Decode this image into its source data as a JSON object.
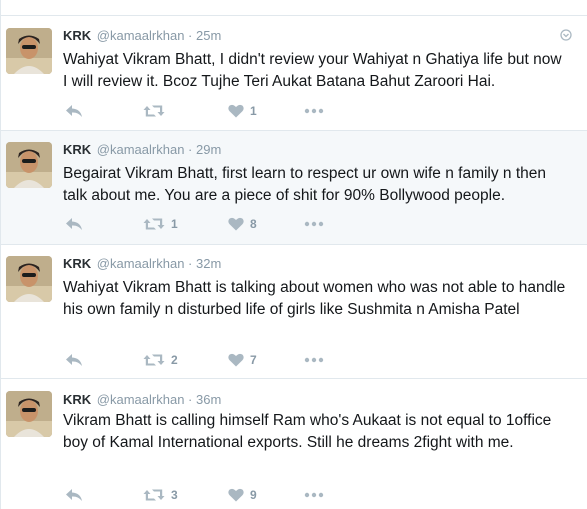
{
  "icons": {
    "reply": "reply-icon",
    "retweet": "retweet-icon",
    "like": "heart-icon",
    "more": "more-dots-icon",
    "caret": "caret-down-icon"
  },
  "colors": {
    "name": "#292f33",
    "muted": "#8899a6",
    "text": "#14171a",
    "icon": "#aab8c2",
    "highlight_bg": "#f5f8fa",
    "border": "#e1e8ed"
  },
  "tweets": [
    {
      "name": "KRK",
      "handle": "@kamaalrkhan",
      "separator": "·",
      "time": "25m",
      "text": "Wahiyat Vikram Bhatt, I didn't review your Wahiyat n Ghatiya life but now I will review it. Bcoz Tujhe Teri Aukat Batana Bahut Zaroori Hai.",
      "retweets": "",
      "likes": "1"
    },
    {
      "name": "KRK",
      "handle": "@kamaalrkhan",
      "separator": "·",
      "time": "29m",
      "text": "Begairat Vikram Bhatt, first learn to respect ur own wife n family n then talk about me. You are a piece of shit for 90% Bollywood people.",
      "retweets": "1",
      "likes": "8"
    },
    {
      "name": "KRK",
      "handle": "@kamaalrkhan",
      "separator": "·",
      "time": "32m",
      "text": "Wahiyat Vikram Bhatt is talking about women who was not able to handle his own family n disturbed life of girls like Sushmita n Amisha Patel",
      "retweets": "2",
      "likes": "7"
    },
    {
      "name": "KRK",
      "handle": "@kamaalrkhan",
      "separator": "·",
      "time": "36m",
      "text": "Vikram Bhatt is calling himself Ram who's Aukaat is not equal to 1office boy of Kamal International exports. Still he dreams 2fight with me.",
      "retweets": "3",
      "likes": "9"
    }
  ]
}
